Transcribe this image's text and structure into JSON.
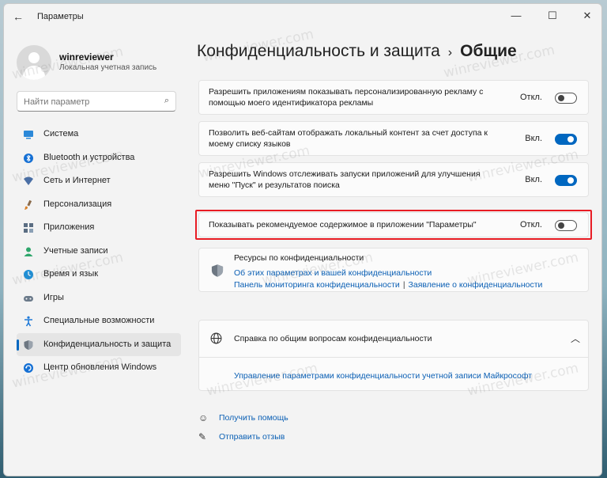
{
  "window": {
    "title": "Параметры",
    "minimize_glyph": "—",
    "maximize_glyph": "☐",
    "close_glyph": "✕",
    "back_glyph": "←"
  },
  "user": {
    "name": "winreviewer",
    "subtitle": "Локальная учетная запись"
  },
  "search": {
    "placeholder": "Найти параметр",
    "icon": "search-icon"
  },
  "sidebar": {
    "items": [
      {
        "label": "Система",
        "icon": "system-icon",
        "color": "#2b88d8"
      },
      {
        "label": "Bluetooth и устройства",
        "icon": "bluetooth-icon",
        "color": "#1570d4"
      },
      {
        "label": "Сеть и Интернет",
        "icon": "network-icon",
        "color": "#4a6fa5"
      },
      {
        "label": "Персонализация",
        "icon": "brush-icon",
        "color": "#d9822b"
      },
      {
        "label": "Приложения",
        "icon": "apps-icon",
        "color": "#5a6d82"
      },
      {
        "label": "Учетные записи",
        "icon": "accounts-icon",
        "color": "#2ea66b"
      },
      {
        "label": "Время и язык",
        "icon": "time-language-icon",
        "color": "#1f8fd6"
      },
      {
        "label": "Игры",
        "icon": "gaming-icon",
        "color": "#6b7a8a"
      },
      {
        "label": "Специальные возможности",
        "icon": "accessibility-icon",
        "color": "#1f7ad8"
      },
      {
        "label": "Конфиденциальность и защита",
        "icon": "shield-icon",
        "color": "#6d7782",
        "active": true
      },
      {
        "label": "Центр обновления Windows",
        "icon": "update-icon",
        "color": "#1570d4"
      }
    ]
  },
  "header": {
    "section": "Конфиденциальность и защита",
    "separator": "›",
    "current": "Общие"
  },
  "settings": [
    {
      "text": "Разрешить приложениям показывать персонализированную рекламу с помощью моего идентификатора рекламы",
      "state": "Откл.",
      "on": false
    },
    {
      "text": "Позволить веб-сайтам отображать локальный контент за счет доступа к моему списку языков",
      "state": "Вкл.",
      "on": true
    },
    {
      "text": "Разрешить Windows отслеживать запуски приложений для улучшения меню \"Пуск\" и результатов поиска",
      "state": "Вкл.",
      "on": true
    },
    {
      "text": "Показывать рекомендуемое содержимое в приложении \"Параметры\"",
      "state": "Откл.",
      "on": false
    }
  ],
  "resources": {
    "title": "Ресурсы по конфиденциальности",
    "link1": "Об этих параметрах и вашей конфиденциальности",
    "link2": "Панель мониторинга конфиденциальности",
    "separator": "|",
    "link3": "Заявление о конфиденциальности"
  },
  "help": {
    "title": "Справка по общим вопросам конфиденциальности",
    "link": "Управление параметрами конфиденциальности учетной записи Майкрософт",
    "chevron": "︿"
  },
  "footer": {
    "get_help": "Получить помощь",
    "feedback": "Отправить отзыв"
  },
  "watermark": "winreviewer.com",
  "colors": {
    "accent": "#0067c0",
    "highlight": "#e81c24",
    "link": "#0a5fb4"
  }
}
